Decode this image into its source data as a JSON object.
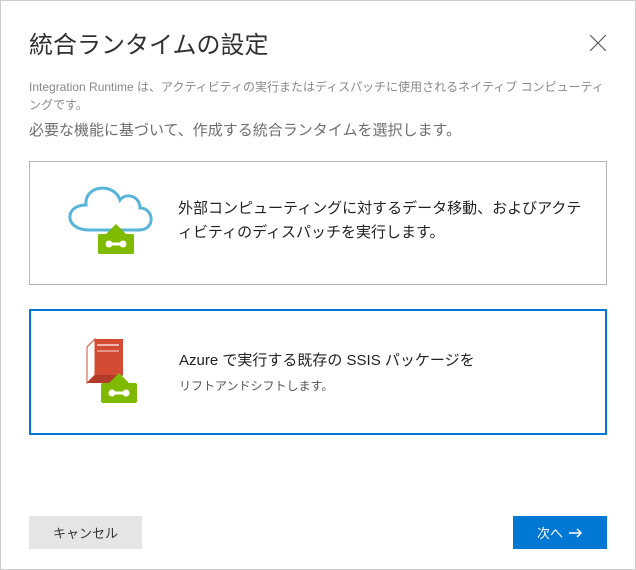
{
  "header": {
    "title": "統合ランタイムの設定"
  },
  "intro": {
    "description": "Integration Runtime は、アクティビティの実行またはディスパッチに使用されるネイティブ コンピューティングです。",
    "subtitle": "必要な機能に基づいて、作成する統合ランタイムを選択します。"
  },
  "options": [
    {
      "title": "外部コンピューティングに対するデータ移動、およびアクティビティのディスパッチを実行します。",
      "desc": "",
      "selected": false
    },
    {
      "title": "Azure で実行する既存の SSIS パッケージを",
      "desc": "リフトアンドシフトします。",
      "selected": true
    }
  ],
  "footer": {
    "cancel_label": "キャンセル",
    "next_label": "次へ"
  }
}
